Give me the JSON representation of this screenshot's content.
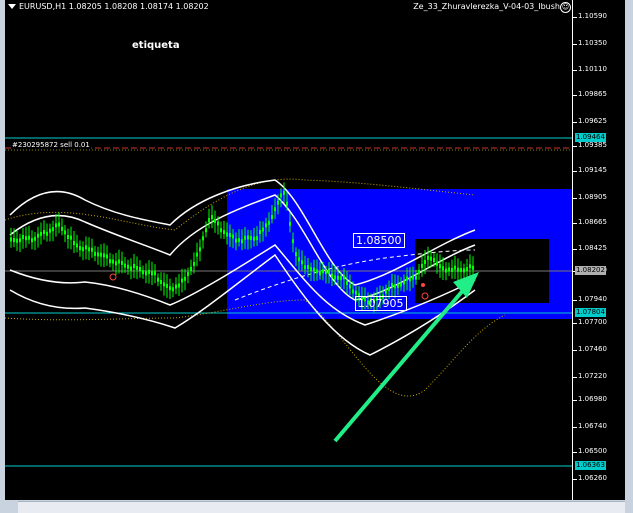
{
  "chart": {
    "symbol_line": "EURUSD,H1  1.08205 1.08208 1.08174 1.08202",
    "ea_name": "Ze_33_Zhuravlerezka_V-04-03_Ibush",
    "label": "etiqueta",
    "order_label": "#230295872 sell 0.01",
    "box_top_label": "1.08500",
    "box_bottom_label": "1.07905",
    "colors": {
      "background": "#000000",
      "blue_zone": "#0000ff",
      "candles": "#00ff00",
      "bands": "#ffffff",
      "level_lines": "#00cccc",
      "arrow": "#22ee88"
    }
  },
  "price_axis": {
    "ticks": [
      "1.10590",
      "1.10350",
      "1.10110",
      "1.09865",
      "1.09625",
      "1.09385",
      "1.09145",
      "1.08905",
      "1.08665",
      "1.08425",
      "1.08180",
      "1.07940",
      "1.07700",
      "1.07460",
      "1.07220",
      "1.06980",
      "1.06740",
      "1.06500",
      "1.06260"
    ],
    "tags": [
      {
        "text": "1.09464",
        "bg": "#00cccc",
        "fg": "#000000"
      },
      {
        "text": "1.08202",
        "bg": "#b0b0b0",
        "fg": "#000000"
      },
      {
        "text": "1.07804",
        "bg": "#00cccc",
        "fg": "#000000"
      },
      {
        "text": "1.06363",
        "bg": "#00cccc",
        "fg": "#000000"
      }
    ]
  }
}
